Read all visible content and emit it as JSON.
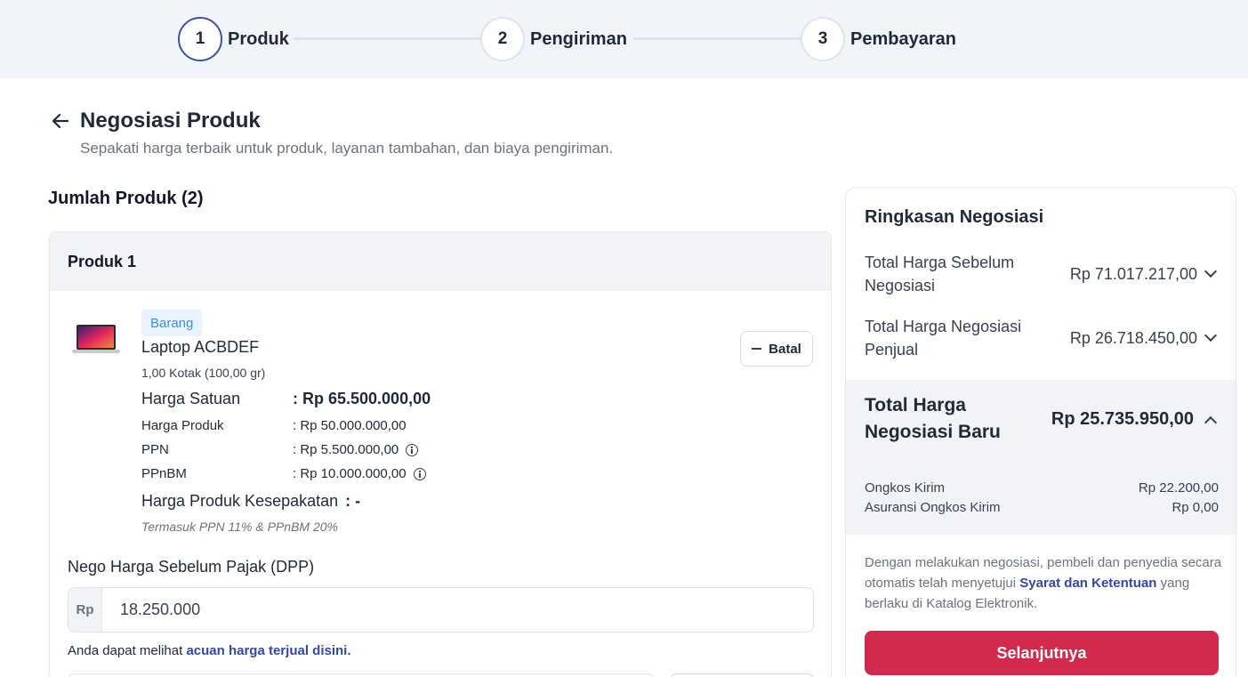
{
  "stepper": {
    "steps": [
      {
        "number": "1",
        "label": "Produk",
        "active": true
      },
      {
        "number": "2",
        "label": "Pengiriman",
        "active": false
      },
      {
        "number": "3",
        "label": "Pembayaran",
        "active": false
      }
    ]
  },
  "header": {
    "title": "Negosiasi Produk",
    "subtitle": "Sepakati harga terbaik untuk produk, layanan tambahan, dan biaya pengiriman."
  },
  "products": {
    "section_title": "Jumlah Produk (2)",
    "card": {
      "title": "Produk 1",
      "type_badge": "Barang",
      "name": "Laptop ACBDEF",
      "quantity": "1,00 Kotak (100,00 gr)",
      "cancel_label": "Batal",
      "price_rows": [
        {
          "label": "Harga Satuan",
          "value": ": Rp 65.500.000,00"
        },
        {
          "label": "Harga Produk",
          "value": ": Rp 50.000.000,00"
        },
        {
          "label": "PPN",
          "value": ": Rp 5.500.000,00"
        },
        {
          "label": "PPnBM",
          "value": ": Rp 10.000.000,00"
        },
        {
          "label": "Harga Produk Kesepakatan",
          "value": ": -"
        }
      ],
      "tax_note": "Termasuk PPN 11% & PPnBM 20%",
      "nego_label": "Nego Harga Sebelum Pajak (DPP)",
      "nego_prefix": "Rp",
      "nego_value": "18.250.000",
      "helper_text": "Anda dapat melihat",
      "helper_link": "acuan harga terjual disini."
    }
  },
  "summary": {
    "title": "Ringkasan Negosiasi",
    "rows": [
      {
        "label": "Total Harga Sebelum Negosiasi",
        "value": "Rp 71.017.217,00"
      },
      {
        "label": "Total Harga Negosiasi Penjual",
        "value": "Rp 26.718.450,00"
      }
    ],
    "total_label": "Total Harga Negosiasi Baru",
    "total_value": "Rp 25.735.950,00",
    "fees": [
      {
        "label": "Ongkos Kirim",
        "value": "Rp 22.200,00"
      },
      {
        "label": "Asuransi Ongkos Kirim",
        "value": "Rp 0,00"
      }
    ],
    "terms_before": "Dengan melakukan negosiasi, pembeli dan penyedia secara otomatis telah menyetujui",
    "terms_link": "Syarat dan Ketentuan",
    "terms_after": "yang berlaku di Katalog Elektronik.",
    "next_label": "Selanjutnya"
  },
  "colors": {
    "accent": "#3c50a8",
    "primary_button": "#d22a4c",
    "stepper_bg": "#f1f5fa"
  }
}
